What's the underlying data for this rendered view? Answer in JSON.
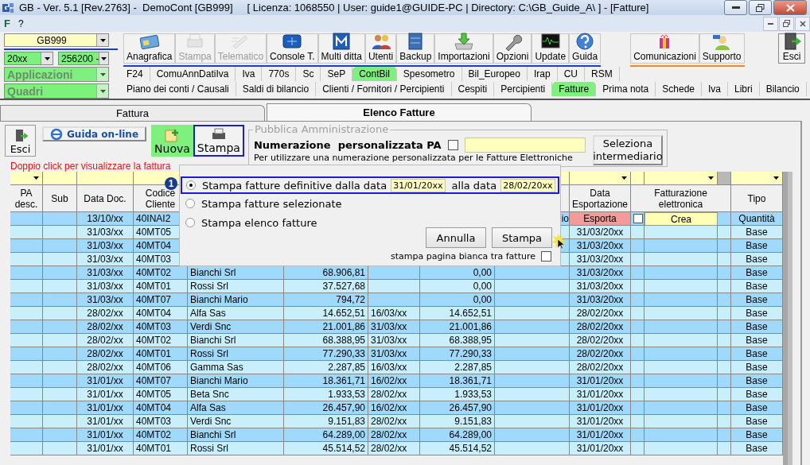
{
  "window": {
    "title": "GB - Ver. 5.1 [Rev.2763] -  DemoCont [GB999]     [ Licenza: 1068550 | User: guide1@GUIDE-PC | Directory: C:\\GB_Guide_A\\ ] - [Fatture]"
  },
  "menu": [
    "F",
    "?"
  ],
  "selectors": {
    "company": "GB999",
    "year": "20xx",
    "code": "256200 -",
    "applications": "Applicazioni",
    "forms": "Quadri"
  },
  "toolbar": {
    "main": [
      {
        "label": "Anagrafica",
        "kind": "card",
        "disabled": false
      },
      {
        "label": "Stampa",
        "kind": "printer",
        "disabled": true
      },
      {
        "label": "Telematico",
        "kind": "send",
        "disabled": true
      },
      {
        "label": "Console T.",
        "kind": "console",
        "disabled": false
      },
      {
        "label": "Multi ditta",
        "kind": "letter",
        "disabled": false
      },
      {
        "label": "Utenti",
        "kind": "users",
        "disabled": false
      },
      {
        "label": "Backup",
        "kind": "cabinet",
        "disabled": false
      },
      {
        "label": "Importazioni",
        "kind": "import",
        "disabled": false
      },
      {
        "label": "Opzioni",
        "kind": "wrench",
        "disabled": false
      },
      {
        "label": "Update",
        "kind": "monitor",
        "disabled": false
      },
      {
        "label": "Guida",
        "kind": "help",
        "disabled": false
      }
    ],
    "extra": [
      {
        "label": "Comunicazioni",
        "kind": "gift",
        "disabled": false
      },
      {
        "label": "Supporto",
        "kind": "support",
        "disabled": false
      }
    ],
    "exit": {
      "label": "Esci",
      "kind": "door",
      "disabled": false
    }
  },
  "module_tabs": [
    {
      "label": "F24",
      "selected": false
    },
    {
      "label": "ComuAnnDatiIva",
      "selected": false
    },
    {
      "label": "Iva",
      "selected": false
    },
    {
      "label": "770s",
      "selected": false
    },
    {
      "label": "Sc",
      "selected": false
    },
    {
      "label": "SeP",
      "selected": false
    },
    {
      "label": "ContBil",
      "selected": true
    },
    {
      "label": "Spesometro",
      "selected": false
    },
    {
      "label": "Bil_Europeo",
      "selected": false
    },
    {
      "label": "Irap",
      "selected": false
    },
    {
      "label": "CU",
      "selected": false
    },
    {
      "label": "RSM",
      "selected": false
    }
  ],
  "section_tabs": [
    {
      "label": "Piano dei conti / Causali",
      "selected": false
    },
    {
      "label": "Saldi di bilancio",
      "selected": false
    },
    {
      "label": "Clienti / Fornitori / Percipienti",
      "selected": false
    },
    {
      "label": "Cespiti",
      "selected": false
    },
    {
      "label": "Percipienti",
      "selected": false
    },
    {
      "label": "Fatture",
      "selected": true
    },
    {
      "label": "Prima nota",
      "selected": false
    },
    {
      "label": "Schede",
      "selected": false
    },
    {
      "label": "Iva",
      "selected": false
    },
    {
      "label": "Libri",
      "selected": false
    },
    {
      "label": "Bilancio",
      "selected": false
    }
  ],
  "page_tabs": [
    {
      "label": "Fattura",
      "selected": false
    },
    {
      "label": "Elenco Fatture",
      "selected": true
    }
  ],
  "actions": [
    {
      "label": "Esci",
      "kind": "exit",
      "highlighted": false
    },
    {
      "label": "Guida on-line",
      "kind": "online",
      "highlighted": false
    },
    {
      "label": "Nuova",
      "kind": "new",
      "highlighted": false
    },
    {
      "label": "Stampa",
      "kind": "print",
      "highlighted": true
    }
  ],
  "pa_group": {
    "title": "Pubblica Amministrazione",
    "label": "Numerazione  personalizzata PA",
    "checked": false,
    "hint": "Per utilizzare una numerazione personalizzata per le Fatture Elettroniche",
    "button": "Seleziona intermediario"
  },
  "notice": "Doppio click per visualizzare la fattura",
  "table": {
    "headers": {
      "pa": "PA desc.",
      "sub": "Sub",
      "date": "Data Doc.",
      "code": "Codice Cliente",
      "export_date": "Data Esportazione",
      "einvoice": "Fatturazione elettronica",
      "type": "Tipo"
    },
    "rows": [
      {
        "date": "13/10/xx",
        "code": "40INAI2",
        "column_9": "io",
        "export_action": "Esporta",
        "einvoice_checked": false,
        "einvoice_action": "Crea",
        "type": "Quantità"
      },
      {
        "date": "31/03/xx",
        "code": "40MT05",
        "export_date": "31/03/20xx",
        "type": "Base"
      },
      {
        "date": "31/03/xx",
        "code": "40MT04",
        "export_date": "31/03/20xx",
        "type": "Base"
      },
      {
        "date": "31/03/xx",
        "code": "40MT03",
        "export_date": "31/03/20xx",
        "type": "Base"
      },
      {
        "date": "31/03/xx",
        "code": "40MT02",
        "customer": "Bianchi Srl",
        "amount": "68.906,81",
        "amount_2": "0,00",
        "export_date": "31/03/20xx",
        "type": "Base"
      },
      {
        "date": "31/03/xx",
        "code": "40MT01",
        "customer": "Rossi Srl",
        "amount": "37.527,68",
        "amount_2": "0,00",
        "export_date": "31/03/20xx",
        "type": "Base"
      },
      {
        "date": "31/03/xx",
        "code": "40MT07",
        "customer": "Bianchi Mario",
        "amount": "794,72",
        "amount_2": "0,00",
        "export_date": "31/03/20xx",
        "type": "Base"
      },
      {
        "date": "28/02/xx",
        "code": "40MT04",
        "customer": "Alfa Sas",
        "amount": "14.652,51",
        "date_2": "16/03/xx",
        "amount_2": "14.652,51",
        "export_date": "28/02/20xx",
        "type": "Base"
      },
      {
        "date": "28/02/xx",
        "code": "40MT03",
        "customer": "Verdi Snc",
        "amount": "21.001,86",
        "date_2": "31/03/xx",
        "amount_2": "21.001,86",
        "export_date": "28/02/20xx",
        "type": "Base"
      },
      {
        "date": "28/02/xx",
        "code": "40MT02",
        "customer": "Bianchi Srl",
        "amount": "68.388,95",
        "date_2": "31/03/xx",
        "amount_2": "68.388,95",
        "export_date": "28/02/20xx",
        "type": "Base"
      },
      {
        "date": "28/02/xx",
        "code": "40MT01",
        "customer": "Rossi Srl",
        "amount": "77.290,33",
        "date_2": "31/03/xx",
        "amount_2": "77.290,33",
        "export_date": "28/02/20xx",
        "type": "Base"
      },
      {
        "date": "28/02/xx",
        "code": "40MT06",
        "customer": "Gamma Sas",
        "amount": "2.287,85",
        "date_2": "16/03/xx",
        "amount_2": "2.287,85",
        "export_date": "28/02/20xx",
        "type": "Base"
      },
      {
        "date": "31/01/xx",
        "code": "40MT07",
        "customer": "Bianchi Mario",
        "amount": "18.361,71",
        "date_2": "16/02/xx",
        "amount_2": "18.361,71",
        "export_date": "31/01/20xx",
        "type": "Base"
      },
      {
        "date": "31/01/xx",
        "code": "40MT05",
        "customer": "Beta Snc",
        "amount": "1.933,53",
        "date_2": "28/02/xx",
        "amount_2": "1.933,53",
        "export_date": "31/01/20xx",
        "type": "Base"
      },
      {
        "date": "31/01/xx",
        "code": "40MT04",
        "customer": "Alfa Sas",
        "amount": "26.457,90",
        "date_2": "16/02/xx",
        "amount_2": "26.457,90",
        "export_date": "31/01/20xx",
        "type": "Base"
      },
      {
        "date": "31/01/xx",
        "code": "40MT03",
        "customer": "Verdi Snc",
        "amount": "9.151,83",
        "date_2": "28/02/xx",
        "amount_2": "9.151,83",
        "export_date": "31/01/20xx",
        "type": "Base"
      },
      {
        "date": "31/01/xx",
        "code": "40MT02",
        "customer": "Bianchi Srl",
        "amount": "64.289,00",
        "date_2": "28/02/xx",
        "amount_2": "64.289,00",
        "export_date": "31/01/20xx",
        "type": "Base"
      },
      {
        "date": "31/01/xx",
        "code": "40MT01",
        "customer": "Rossi Srl",
        "amount": "45.514,52",
        "date_2": "28/02/xx",
        "amount_2": "45.514,52",
        "export_date": "31/01/20xx",
        "type": "Base"
      }
    ]
  },
  "print_dialog": {
    "badge": "1",
    "options": [
      {
        "label": "Stampa fatture definitive dalla data",
        "selected": true
      },
      {
        "label": "Stampa fatture selezionate",
        "selected": false
      },
      {
        "label": "Stampa elenco fatture",
        "selected": false
      }
    ],
    "from_date": "31/01/20xx",
    "to_label": "alla data",
    "to_date": "28/02/20xx",
    "buttons": [
      "Annulla",
      "Stampa"
    ],
    "blank_page": {
      "label": "stampa pagina bianca tra fatture",
      "checked": false
    }
  }
}
